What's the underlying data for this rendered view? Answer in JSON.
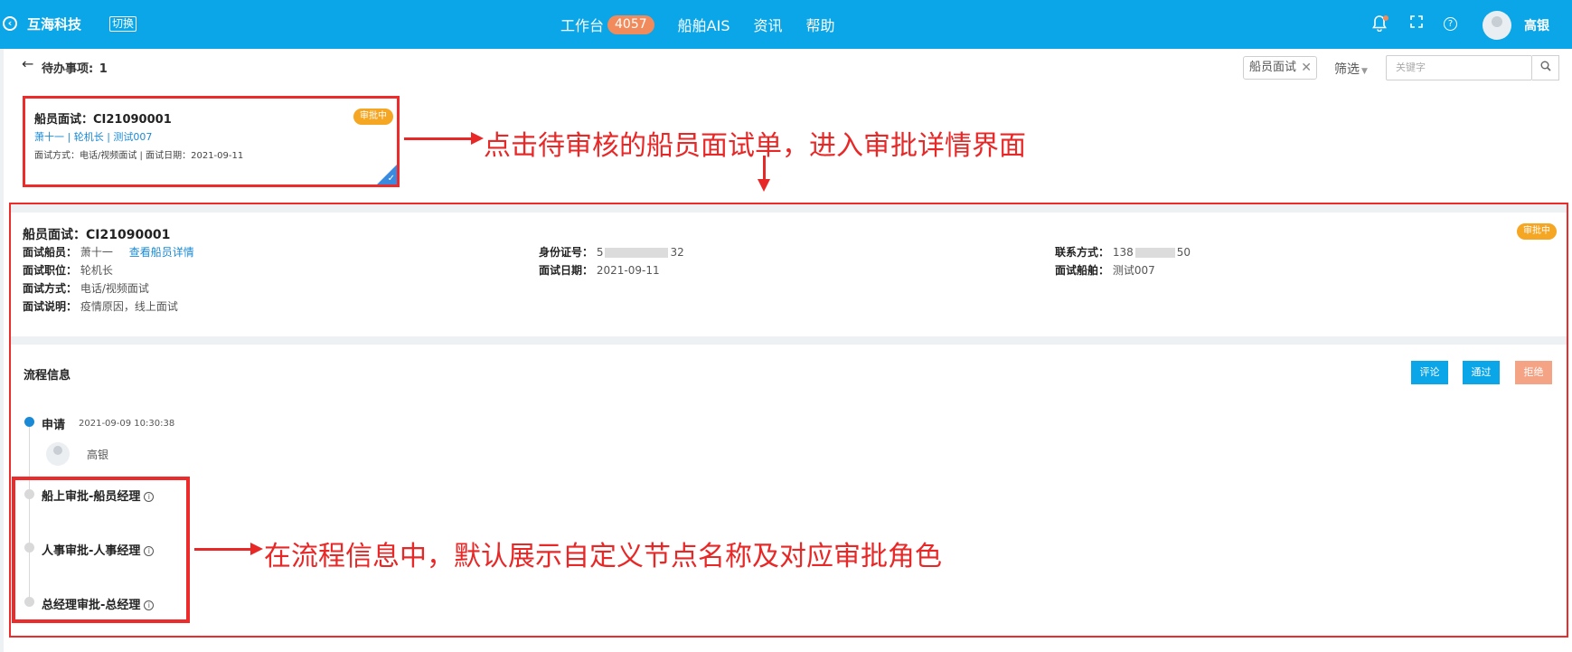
{
  "header": {
    "brand": "互海科技",
    "switch_label": "切换",
    "nav": [
      {
        "label": "工作台",
        "badge": "4057"
      },
      {
        "label": "船舶AIS"
      },
      {
        "label": "资讯"
      },
      {
        "label": "帮助"
      }
    ],
    "user_name": "高银",
    "icons": [
      "back-circle-icon",
      "bell-icon",
      "expand-icon",
      "help-icon"
    ]
  },
  "toolbar": {
    "todo_label": "待办事项:",
    "todo_count": "1",
    "filter_tag": "船员面试",
    "filter_button": "筛选",
    "search_placeholder": "关键字"
  },
  "card": {
    "title": "船员面试：CI21090001",
    "status": "审批中",
    "crew": "萧十一",
    "position": "轮机长",
    "ship": "测试007",
    "method_label": "面试方式：",
    "method": "电话/视频面试",
    "date_label": "面试日期：",
    "date": "2021-09-11"
  },
  "annotations": {
    "note1": "点击待审核的船员面试单，进入审批详情界面",
    "note2": "在流程信息中，默认展示自定义节点名称及对应审批角色"
  },
  "detail": {
    "title": "船员面试：CI21090001",
    "status": "审批中",
    "fields": {
      "crew_label": "面试船员：",
      "crew": "萧十一",
      "crew_link": "查看船员详情",
      "position_label": "面试职位：",
      "position": "轮机长",
      "method_label": "面试方式：",
      "method": "电话/视频面试",
      "note_label": "面试说明：",
      "note": "疫情原因，线上面试",
      "id_label": "身份证号：",
      "id_prefix": "5",
      "id_suffix": "32",
      "date_label": "面试日期：",
      "date": "2021-09-11",
      "contact_label": "联系方式：",
      "contact_prefix": "138",
      "contact_suffix": "50",
      "ship_label": "面试船舶：",
      "ship": "测试007"
    }
  },
  "flow": {
    "title": "流程信息",
    "buttons": {
      "comment": "评论",
      "pass": "通过",
      "reject": "拒绝"
    },
    "steps": [
      {
        "name": "申请",
        "time": "2021-09-09 10:30:38",
        "user": "高银",
        "active": true
      },
      {
        "name": "船上审批-船员经理",
        "active": false
      },
      {
        "name": "人事审批-人事经理",
        "active": false
      },
      {
        "name": "总经理审批-总经理",
        "active": false
      }
    ]
  },
  "colors": {
    "primary": "#0aa6e8",
    "badge": "#f28b5c",
    "status": "#f5a623",
    "reject": "#f5a385",
    "annotation": "#e82727"
  }
}
